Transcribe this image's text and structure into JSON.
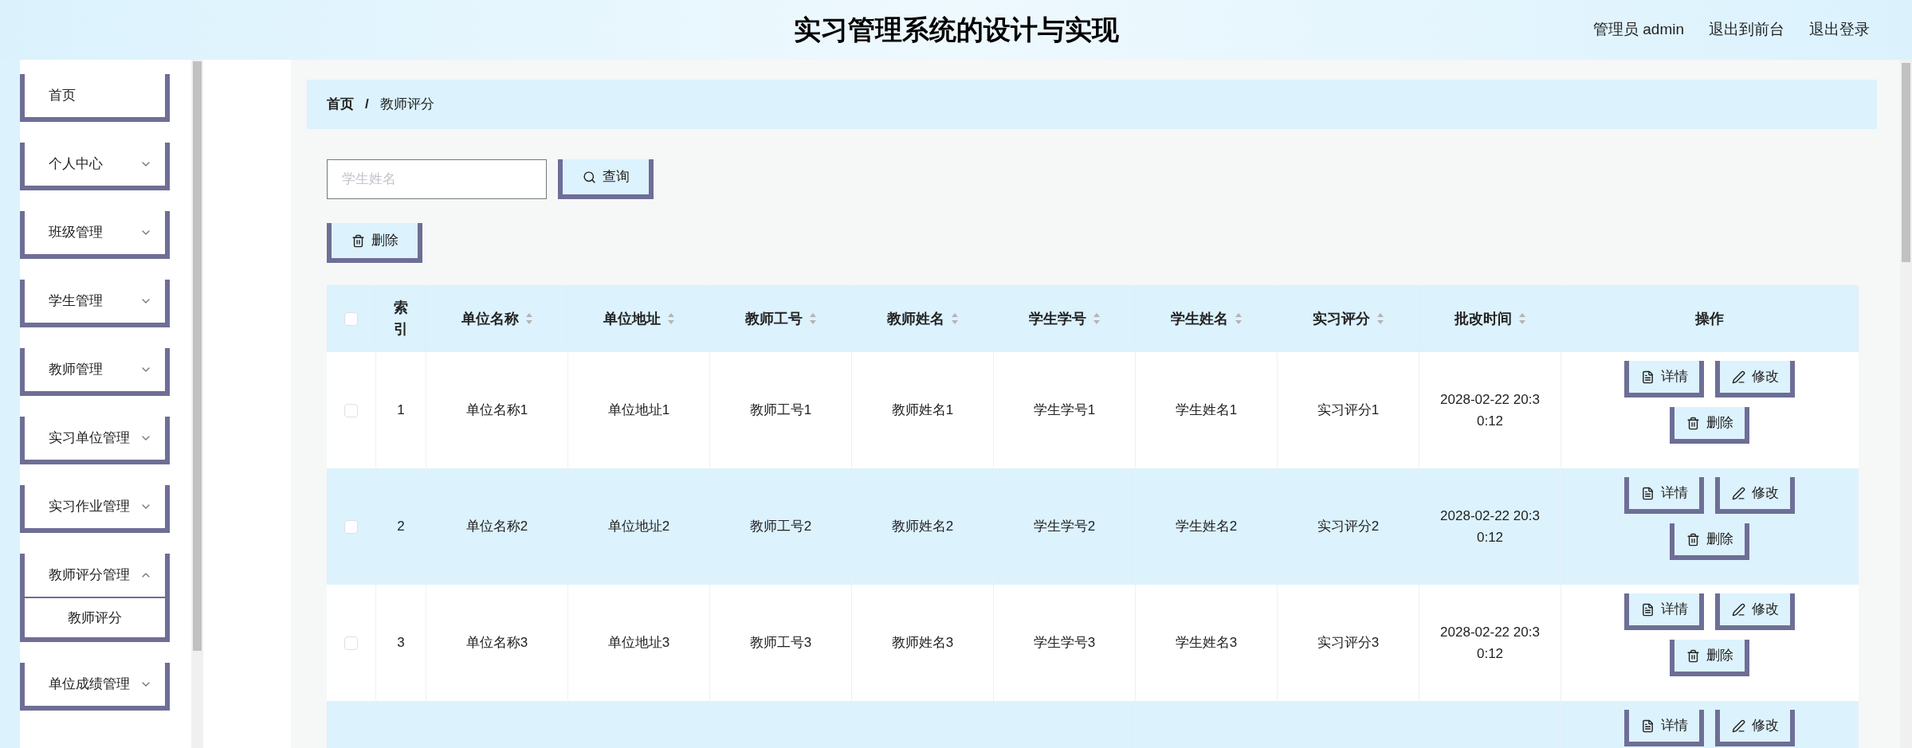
{
  "header": {
    "title": "实习管理系统的设计与实现",
    "user": "管理员 admin",
    "links": [
      "退出到前台",
      "退出登录"
    ]
  },
  "sidebar": {
    "items": [
      {
        "label": "首页",
        "has_children": false,
        "expanded": false
      },
      {
        "label": "个人中心",
        "has_children": true,
        "expanded": false
      },
      {
        "label": "班级管理",
        "has_children": true,
        "expanded": false
      },
      {
        "label": "学生管理",
        "has_children": true,
        "expanded": false
      },
      {
        "label": "教师管理",
        "has_children": true,
        "expanded": false
      },
      {
        "label": "实习单位管理",
        "has_children": true,
        "expanded": false
      },
      {
        "label": "实习作业管理",
        "has_children": true,
        "expanded": false
      },
      {
        "label": "教师评分管理",
        "has_children": true,
        "expanded": true,
        "children": [
          {
            "label": "教师评分",
            "selected": true
          }
        ]
      },
      {
        "label": "单位成绩管理",
        "has_children": true,
        "expanded": false
      }
    ]
  },
  "breadcrumb": {
    "items": [
      "首页",
      "教师评分"
    ],
    "separator": "/"
  },
  "search": {
    "placeholder": "学生姓名",
    "button": "查询"
  },
  "toolbar": {
    "delete_button": "删除"
  },
  "table": {
    "columns": [
      {
        "label": "索引",
        "sortable": false
      },
      {
        "label": "单位名称",
        "sortable": true
      },
      {
        "label": "单位地址",
        "sortable": true
      },
      {
        "label": "教师工号",
        "sortable": true
      },
      {
        "label": "教师姓名",
        "sortable": true
      },
      {
        "label": "学生学号",
        "sortable": true
      },
      {
        "label": "学生姓名",
        "sortable": true
      },
      {
        "label": "实习评分",
        "sortable": true
      },
      {
        "label": "批改时间",
        "sortable": true
      },
      {
        "label": "操作",
        "sortable": false
      }
    ],
    "header_checked": false,
    "rows": [
      {
        "checked": false,
        "cells": [
          "1",
          "单位名称1",
          "单位地址1",
          "教师工号1",
          "教师姓名1",
          "学生学号1",
          "学生姓名1",
          "实习评分1",
          "2028-02-22 20:30:12"
        ],
        "actions": [
          {
            "kind": "detail",
            "label": "详情"
          },
          {
            "kind": "edit",
            "label": "修改"
          },
          {
            "kind": "delete",
            "label": "删除"
          }
        ]
      },
      {
        "checked": false,
        "cells": [
          "2",
          "单位名称2",
          "单位地址2",
          "教师工号2",
          "教师姓名2",
          "学生学号2",
          "学生姓名2",
          "实习评分2",
          "2028-02-22 20:30:12"
        ],
        "actions": [
          {
            "kind": "detail",
            "label": "详情"
          },
          {
            "kind": "edit",
            "label": "修改"
          },
          {
            "kind": "delete",
            "label": "删除"
          }
        ]
      },
      {
        "checked": false,
        "cells": [
          "3",
          "单位名称3",
          "单位地址3",
          "教师工号3",
          "教师姓名3",
          "学生学号3",
          "学生姓名3",
          "实习评分3",
          "2028-02-22 20:30:12"
        ],
        "actions": [
          {
            "kind": "detail",
            "label": "详情"
          },
          {
            "kind": "edit",
            "label": "修改"
          },
          {
            "kind": "delete",
            "label": "删除"
          }
        ]
      },
      {
        "actions": [
          {
            "kind": "detail",
            "label": "详情"
          },
          {
            "kind": "edit",
            "label": "修改"
          }
        ]
      }
    ]
  }
}
